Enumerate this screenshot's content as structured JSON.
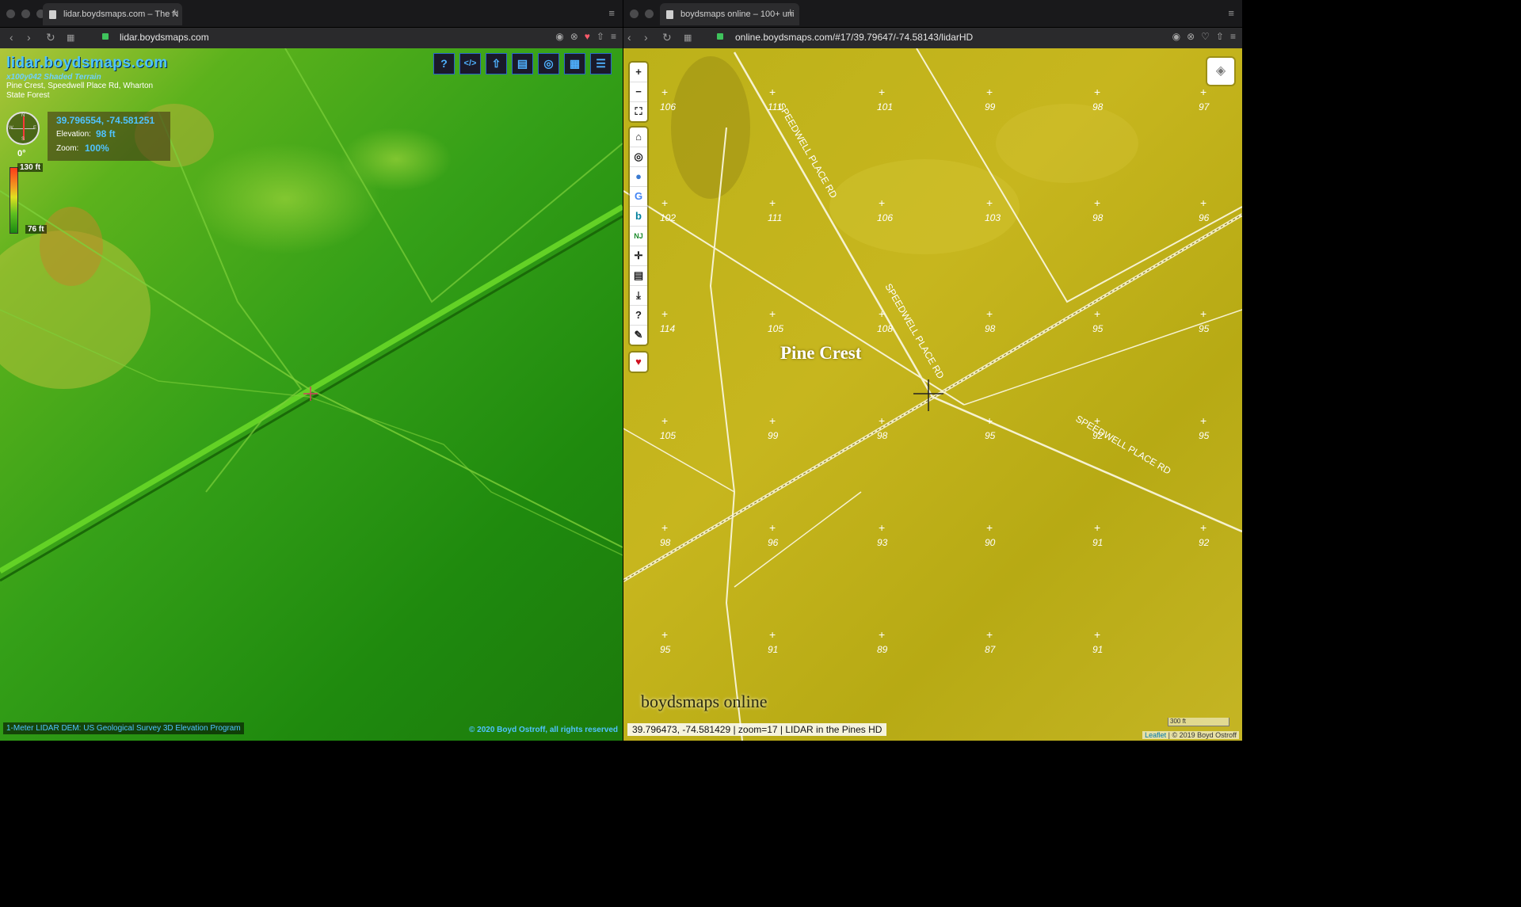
{
  "left_window": {
    "tab_title": "lidar.boydsmaps.com – The N",
    "url": "lidar.boydsmaps.com",
    "site_title": "lidar.boydsmaps.com",
    "map_subtitle": "x100y042 Shaded Terrain",
    "place_name": "Pine Crest, Speedwell Place Rd, Wharton State Forest",
    "coordinates": "39.796554, -74.581251",
    "elevation_label": "Elevation:",
    "elevation_value": "98 ft",
    "zoom_label": "Zoom:",
    "zoom_value": "100%",
    "heading": "0°",
    "scale_max": "130 ft",
    "scale_min": "76 ft",
    "tools": [
      {
        "icon": "help-icon",
        "glyph": "?"
      },
      {
        "icon": "code-icon",
        "glyph": "</>"
      },
      {
        "icon": "share-icon",
        "glyph": "⇧"
      },
      {
        "icon": "document-icon",
        "glyph": "▤"
      },
      {
        "icon": "globe-icon",
        "glyph": "◎"
      },
      {
        "icon": "grid-icon",
        "glyph": "▦"
      },
      {
        "icon": "settings-sliders-icon",
        "glyph": "☰"
      }
    ],
    "credit_left": "1-Meter LIDAR DEM: US Geological Survey 3D Elevation Program",
    "credit_right": "© 2020 Boyd Ostroff, all rights reserved"
  },
  "right_window": {
    "tab_title": "boydsmaps online – 100+ uni",
    "url": "online.boydsmaps.com/#17/39.79647/-74.58143/lidarHD",
    "place_label": "Pine Crest",
    "brand": "boydsmaps online",
    "status": "39.796473, -74.581429 | zoom=17 | LIDAR in the Pines HD",
    "attribution_link": "Leaflet",
    "attribution_text": "| © 2019 Boyd Ostroff",
    "scale_label": "300 ft",
    "road_labels": [
      "SPEEDWELL PLACE RD",
      "SPEEDWELL PLACE RD",
      "SPEEDWELL PLACE RD"
    ],
    "elevation_marks": [
      "106",
      "111",
      "101",
      "99",
      "98",
      "97",
      "102",
      "111",
      "106",
      "103",
      "98",
      "96",
      "114",
      "105",
      "108",
      "98",
      "95",
      "95",
      "105",
      "99",
      "98",
      "95",
      "92",
      "95",
      "98",
      "96",
      "93",
      "90",
      "91",
      "92",
      "95",
      "91",
      "89",
      "87",
      "91"
    ]
  },
  "colors": {
    "accent_blue": "#4fc3ff",
    "heart": "#ff5a6a",
    "map_green": "#2a9a14",
    "map_yellow": "#c2b31c"
  }
}
